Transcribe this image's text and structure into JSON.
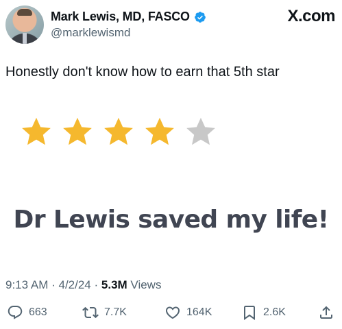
{
  "author": {
    "name": "Mark Lewis, MD, FASCO",
    "handle": "@marklewismd",
    "verified": true
  },
  "brand": "X.com",
  "tweet": {
    "text": "Honestly don't know how to earn that 5th star",
    "image": {
      "rating": 4,
      "max_rating": 5,
      "star_color": "#f5b82e",
      "empty_star_color": "#c8c8c8",
      "review_text": "Dr Lewis saved my life!"
    }
  },
  "meta": {
    "time": "9:13 AM",
    "date": "4/2/24",
    "views_count": "5.3M",
    "views_label": "Views"
  },
  "actions": {
    "replies": "663",
    "reposts": "7.7K",
    "likes": "164K",
    "bookmarks": "2.6K"
  },
  "icons": {
    "reply": "reply-icon",
    "repost": "repost-icon",
    "like": "like-icon",
    "bookmark": "bookmark-icon",
    "share": "share-icon",
    "verified": "verified-badge-icon"
  }
}
